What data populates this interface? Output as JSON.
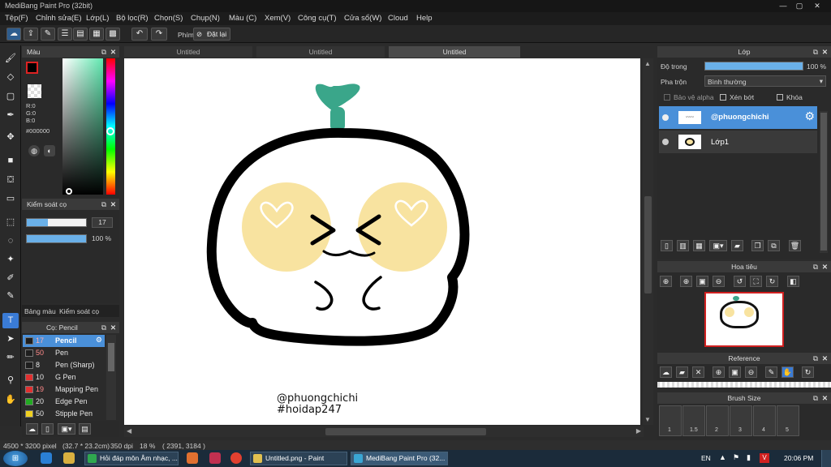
{
  "window": {
    "title": "MediBang Paint Pro (32bit)"
  },
  "menu": [
    "Tệp(F)",
    "Chỉnh sửa(E)",
    "Lớp(L)",
    "Bộ lọc(R)",
    "Chọn(S)",
    "Chụp(N)",
    "Màu (C)",
    "Xem(V)",
    "Công cụ(T)",
    "Cửa sổ(W)",
    "Cloud",
    "Help"
  ],
  "toolbar": {
    "shortcut_label": "Phím",
    "reset_label": "Đặt lại"
  },
  "tabs": [
    "Untitled",
    "Untitled",
    "Untitled"
  ],
  "color_panel": {
    "title": "Màu",
    "r": "R:0",
    "g": "G:0",
    "b": "B:0",
    "hex": "#000000",
    "current_color": "#000000"
  },
  "brush_control": {
    "title": "Kiểm soát cọ",
    "size_value": "17",
    "opacity_value": "100 %",
    "tab_palette": "Bảng màu",
    "tab_brush_control": "Kiểm soát cọ"
  },
  "brush_panel": {
    "title": "Cọ: Pencil",
    "items": [
      {
        "size": "17",
        "name": "Pencil",
        "color": "#1e1e1e",
        "selected": true
      },
      {
        "size": "50",
        "name": "Pen",
        "color": "#1e1e1e"
      },
      {
        "size": "8",
        "name": "Pen (Sharp)",
        "color": "#1e1e1e"
      },
      {
        "size": "10",
        "name": "G Pen",
        "color": "#e03030"
      },
      {
        "size": "19",
        "name": "Mapping Pen",
        "color": "#e03030"
      },
      {
        "size": "20",
        "name": "Edge Pen",
        "color": "#22aa22"
      },
      {
        "size": "50",
        "name": "Stipple Pen",
        "color": "#f0d020"
      }
    ]
  },
  "layer_panel": {
    "title": "Lớp",
    "opacity_label": "Độ trong",
    "opacity_value": "100 %",
    "blend_label": "Pha trộn",
    "blend_value": "Bình thường",
    "protect_alpha": "Bảo vệ alpha",
    "clipping": "Xén bớt",
    "lock": "Khóa",
    "layers": [
      {
        "name": "@phuongchichi",
        "selected": true
      },
      {
        "name": "Lớp1",
        "selected": false
      }
    ]
  },
  "navigator": {
    "title": "Hoa tiêu"
  },
  "reference": {
    "title": "Reference"
  },
  "brush_size": {
    "title": "Brush Size",
    "values": [
      "1",
      "1.5",
      "2",
      "3",
      "4",
      "5"
    ]
  },
  "canvas_text": {
    "line1": "@phuongchichi",
    "line2": "#hoidap247"
  },
  "status": {
    "size": "4500 * 3200 pixel",
    "cm": "(32.7 * 23.2cm)",
    "dpi": "350 dpi",
    "zoom": "18 %",
    "coords": "( 2391, 3184 )"
  },
  "taskbar": {
    "tasks": [
      "Hỏi đáp môn Âm nhạc, ...",
      "Untitled.png - Paint",
      "MediBang Paint Pro (32..."
    ],
    "lang": "EN",
    "time": "20:06 PM"
  },
  "colors": {
    "accent": "#4a90d9",
    "sprout": "#3aa68a",
    "cheek": "#f8e3a0"
  }
}
